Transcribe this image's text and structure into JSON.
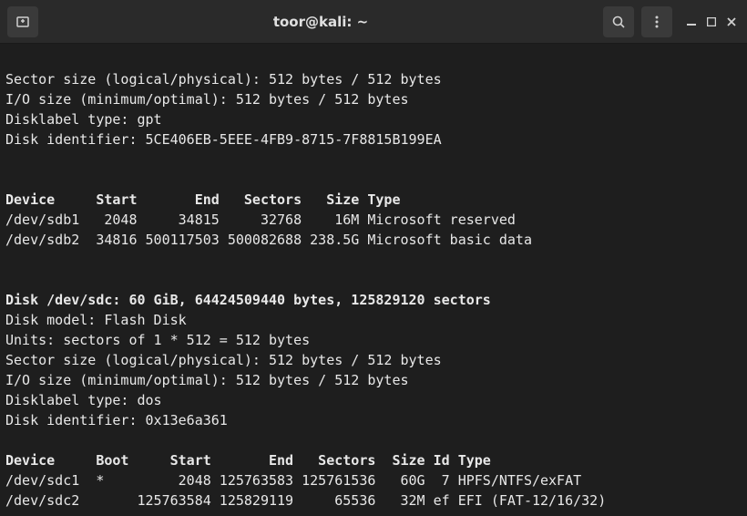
{
  "titlebar": {
    "title": "toor@kali: ~"
  },
  "disk_sdb": {
    "sector_size": "Sector size (logical/physical): 512 bytes / 512 bytes",
    "io_size": "I/O size (minimum/optimal): 512 bytes / 512 bytes",
    "disklabel": "Disklabel type: gpt",
    "identifier": "Disk identifier: 5CE406EB-5EEE-4FB9-8715-7F8815B199EA",
    "header": "Device     Start       End   Sectors   Size Type",
    "row1": "/dev/sdb1   2048     34815     32768    16M Microsoft reserved",
    "row2": "/dev/sdb2  34816 500117503 500082688 238.5G Microsoft basic data"
  },
  "disk_sdc": {
    "summary": "Disk /dev/sdc: 60 GiB, 64424509440 bytes, 125829120 sectors",
    "model": "Disk model: Flash Disk",
    "units": "Units: sectors of 1 * 512 = 512 bytes",
    "sector_size": "Sector size (logical/physical): 512 bytes / 512 bytes",
    "io_size": "I/O size (minimum/optimal): 512 bytes / 512 bytes",
    "disklabel": "Disklabel type: dos",
    "identifier": "Disk identifier: 0x13e6a361",
    "header": "Device     Boot     Start       End   Sectors  Size Id Type",
    "row1": "/dev/sdc1  *         2048 125763583 125761536   60G  7 HPFS/NTFS/exFAT",
    "row2": "/dev/sdc2       125763584 125829119     65536   32M ef EFI (FAT-12/16/32)"
  }
}
